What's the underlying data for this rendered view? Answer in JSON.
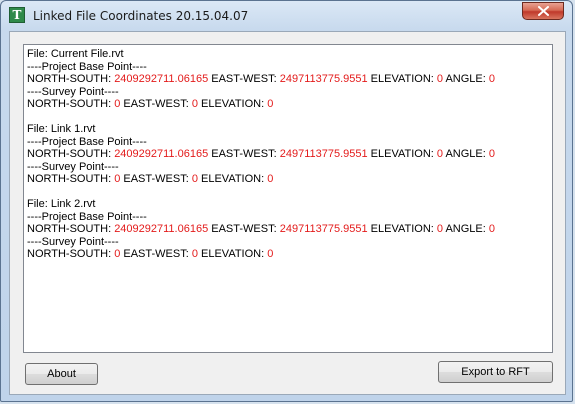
{
  "window": {
    "title": "Linked File Coordinates 20.15.04.07",
    "icon_glyph": "T"
  },
  "files": [
    {
      "file_label": "File: Current File.rvt",
      "pbp_header": "----Project Base Point----",
      "ns_label": "NORTH-SOUTH: ",
      "ns_value": "2409292711.06165",
      "ew_label": " EAST-WEST: ",
      "ew_value": "2497113775.9551",
      "el_label": " ELEVATION: ",
      "el_value": "0",
      "an_label": " ANGLE: ",
      "an_value": "0",
      "sp_header": "----Survey Point----",
      "sp_ns_label": "NORTH-SOUTH: ",
      "sp_ns_value": "0",
      "sp_ew_label": " EAST-WEST: ",
      "sp_ew_value": "0",
      "sp_el_label": " ELEVATION: ",
      "sp_el_value": "0"
    },
    {
      "file_label": "File: Link 1.rvt",
      "pbp_header": "----Project Base Point----",
      "ns_label": "NORTH-SOUTH: ",
      "ns_value": "2409292711.06165",
      "ew_label": " EAST-WEST: ",
      "ew_value": "2497113775.9551",
      "el_label": " ELEVATION: ",
      "el_value": "0",
      "an_label": " ANGLE: ",
      "an_value": "0",
      "sp_header": "----Survey Point----",
      "sp_ns_label": "NORTH-SOUTH: ",
      "sp_ns_value": "0",
      "sp_ew_label": " EAST-WEST: ",
      "sp_ew_value": "0",
      "sp_el_label": " ELEVATION: ",
      "sp_el_value": "0"
    },
    {
      "file_label": "File: Link 2.rvt",
      "pbp_header": "----Project Base Point----",
      "ns_label": "NORTH-SOUTH: ",
      "ns_value": "2409292711.06165",
      "ew_label": " EAST-WEST: ",
      "ew_value": "2497113775.9551",
      "el_label": " ELEVATION: ",
      "el_value": "0",
      "an_label": " ANGLE: ",
      "an_value": "0",
      "sp_header": "----Survey Point----",
      "sp_ns_label": "NORTH-SOUTH: ",
      "sp_ns_value": "0",
      "sp_ew_label": " EAST-WEST: ",
      "sp_ew_value": "0",
      "sp_el_label": " ELEVATION: ",
      "sp_el_value": "0"
    }
  ],
  "buttons": {
    "about": "About",
    "export": "Export to RFT"
  },
  "colors": {
    "value_red": "#e31b1b",
    "close_red": "#c0392b"
  }
}
